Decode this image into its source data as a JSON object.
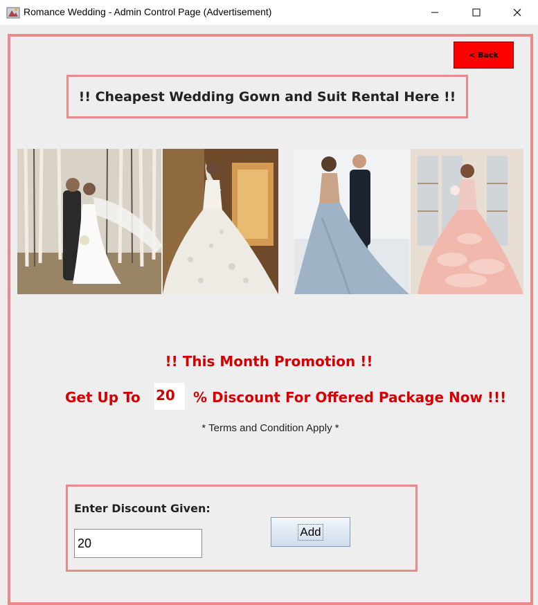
{
  "window": {
    "title": "Romance Wedding - Admin Control Page (Advertisement)",
    "controls": [
      "minimize",
      "maximize",
      "close"
    ]
  },
  "toolbar": {
    "back_label": "< Back"
  },
  "headline": "!! Cheapest Wedding Gown and Suit Rental Here !!",
  "gallery": {
    "photos": [
      {
        "icon": "couple-forest-photo"
      },
      {
        "icon": "lace-ballgown-photo"
      },
      {
        "icon": "blue-gown-couple-photo"
      },
      {
        "icon": "pink-ruffle-gown-photo"
      }
    ]
  },
  "promotion": {
    "title": "!! This Month Promotion !!",
    "prefix": "Get Up To",
    "discount": "20",
    "suffix": "% Discount For Offered Package Now !!!",
    "terms": "* Terms and Condition Apply *"
  },
  "form": {
    "label": "Enter Discount Given:",
    "value": "20",
    "add_label": "Add"
  },
  "colors": {
    "accent_border": "#e88a8a",
    "promo_text": "#d40000",
    "back_button": "#ff0000",
    "background": "#eeeeee"
  }
}
